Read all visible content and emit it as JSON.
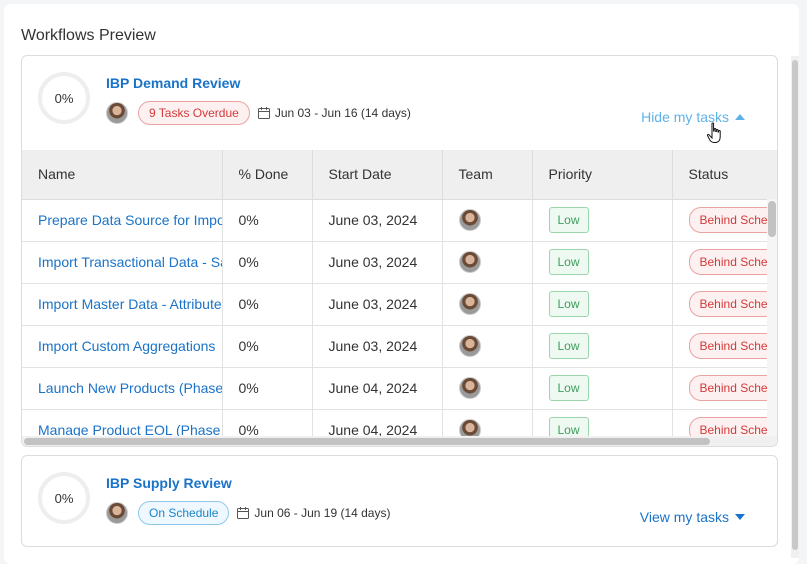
{
  "panel": {
    "title": "Workflows Preview"
  },
  "workflows": [
    {
      "progress": "0%",
      "title": "IBP Demand Review",
      "status_badge": "9 Tasks Overdue",
      "date_range": "Jun 03 - Jun 16 (14 days)",
      "toggle_label": "Hide my tasks",
      "table": {
        "columns": [
          "Name",
          "% Done",
          "Start Date",
          "Team",
          "Priority",
          "Status"
        ],
        "rows": [
          {
            "name": "Prepare Data Source for Import",
            "done": "0%",
            "start": "June 03, 2024",
            "priority": "Low",
            "status": "Behind Schedule"
          },
          {
            "name": "Import Transactional Data - Sales",
            "done": "0%",
            "start": "June 03, 2024",
            "priority": "Low",
            "status": "Behind Schedule"
          },
          {
            "name": "Import Master Data - Attributes",
            "done": "0%",
            "start": "June 03, 2024",
            "priority": "Low",
            "status": "Behind Schedule"
          },
          {
            "name": "Import Custom Aggregations",
            "done": "0%",
            "start": "June 03, 2024",
            "priority": "Low",
            "status": "Behind Schedule"
          },
          {
            "name": "Launch New Products (Phase In)",
            "done": "0%",
            "start": "June 04, 2024",
            "priority": "Low",
            "status": "Behind Schedule"
          },
          {
            "name": "Manage Product EOL (Phase Out)",
            "done": "0%",
            "start": "June 04, 2024",
            "priority": "Low",
            "status": "Behind Schedule"
          }
        ]
      }
    },
    {
      "progress": "0%",
      "title": "IBP Supply Review",
      "status_badge": "On Schedule",
      "date_range": "Jun 06 - Jun 19 (14 days)",
      "toggle_label": "View my tasks"
    }
  ]
}
